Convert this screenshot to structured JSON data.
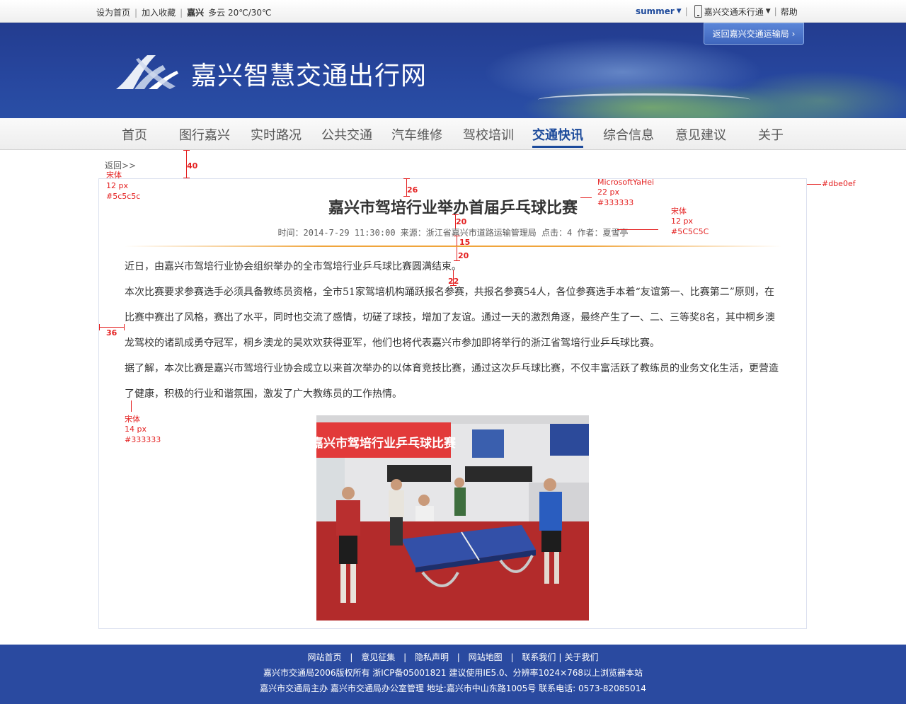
{
  "topbar": {
    "set_home": "设为首页",
    "add_favorite": "加入收藏",
    "city": "嘉兴",
    "weather": "多云 20℃/30℃",
    "user": "summer",
    "app_label": "嘉兴交通禾行通",
    "help": "帮助"
  },
  "header": {
    "site_title": "嘉兴智慧交通出行网",
    "return_label": "返回嘉兴交通运输局",
    "logo_icon": "expressway-logo-icon"
  },
  "nav": {
    "items": [
      "首页",
      "图行嘉兴",
      "实时路况",
      "公共交通",
      "汽车维修",
      "驾校培训",
      "交通快讯",
      "综合信息",
      "意见建议",
      "关于"
    ],
    "active": "交通快讯"
  },
  "article": {
    "back_label": "返回>>",
    "title": "嘉兴市驾培行业举办首届乒乓球比赛",
    "meta": "时间：2014-7-29 11:30:00 来源：浙江省嘉兴市道路运输管理局 点击：4 作者：夏雪亭",
    "paragraphs": [
      "近日，由嘉兴市驾培行业协会组织举办的全市驾培行业乒乓球比赛圆满结束。",
      "本次比赛要求参赛选手必须具备教练员资格，全市51家驾培机构踊跃报名参赛，共报名参赛54人，各位参赛选手本着“友谊第一、比赛第二”原则，在比赛中赛出了风格，赛出了水平，同时也交流了感情，切磋了球技，增加了友谊。通过一天的激烈角逐，最终产生了一、二、三等奖8名，其中桐乡澳龙驾校的诸凯成勇夺冠军，桐乡澳龙的吴欢欢获得亚军，他们也将代表嘉兴市参加即将举行的浙江省驾培行业乒乓球比赛。",
      "据了解，本次比赛是嘉兴市驾培行业协会成立以来首次举办的以体育竞技比赛，通过这次乒乓球比赛，不仅丰富活跃了教练员的业务文化生活，更营造了健康，积极的行业和谐氛围，激发了广大教练员的工作热情。"
    ],
    "photo_banner": "嘉兴市驾培行业乒乓球比赛"
  },
  "annotations": {
    "back_font": [
      "宋体",
      "12 px",
      "#5c5c5c"
    ],
    "title_font": [
      "MicrosoftYaHei",
      "22 px",
      "#333333"
    ],
    "meta_font": [
      "宋体",
      "12 px",
      "#5C5C5C"
    ],
    "body_font": [
      "宋体",
      "14 px",
      "#333333"
    ],
    "border_color": "#dbe0ef",
    "dim_40": "40",
    "dim_26": "26",
    "dim_20a": "20",
    "dim_15": "15",
    "dim_20b": "20",
    "dim_22": "22",
    "dim_36": "36"
  },
  "footer": {
    "links": [
      "网站首页",
      "意见征集",
      "隐私声明",
      "网站地图",
      "联系我们",
      "关于我们"
    ],
    "copyright": "嘉兴市交通局2006版权所有 浙ICP备05001821 建议使用IE5.0、分辨率1024×768以上浏览器本站",
    "sponsor": "嘉兴市交通局主办 嘉兴市交通局办公室管理  地址:嘉兴市中山东路1005号 联系电话: 0573-82085014"
  },
  "colors": {
    "brand_blue": "#2a4aa0",
    "nav_active": "#1c4a9b",
    "annotation_red": "#e42020",
    "panel_border": "#dbe0ef"
  }
}
